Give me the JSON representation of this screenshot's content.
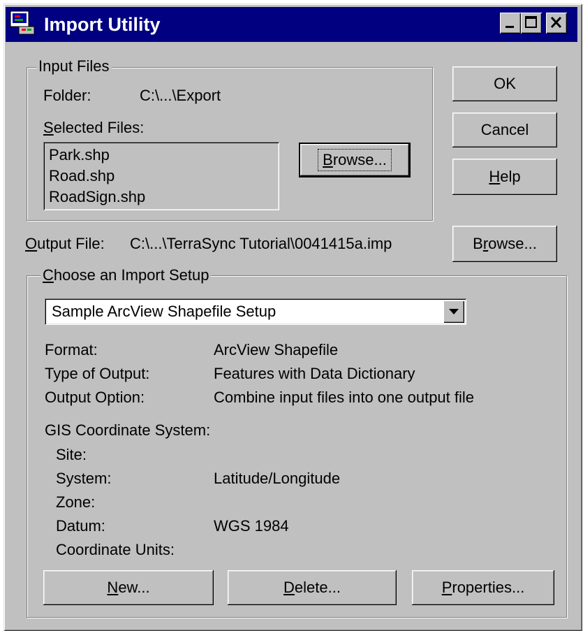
{
  "window": {
    "title": "Import Utility",
    "caption_icons": [
      "minimize-icon",
      "maximize-icon",
      "close-icon"
    ]
  },
  "input_files": {
    "legend": "Input Files",
    "folder_label": "Folder:",
    "folder_value": "C:\\...\\Export",
    "selected_label_hotkey": "S",
    "selected_label_rest": "elected Files:",
    "files": [
      "Park.shp",
      "Road.shp",
      "RoadSign.shp"
    ],
    "browse_hotkey": "B",
    "browse_rest": "rowse..."
  },
  "buttons": {
    "ok": "OK",
    "cancel": "Cancel",
    "help_hotkey": "H",
    "help_rest": "elp"
  },
  "output": {
    "label_hotkey": "O",
    "label_rest": "utput File:",
    "value": "C:\\...\\TerraSync Tutorial\\0041415a.imp",
    "browse_pre": "B",
    "browse_hotkey": "r",
    "browse_rest": "owse..."
  },
  "import_setup": {
    "legend_hotkey": "C",
    "legend_rest": "hoose an Import Setup",
    "selected_setup": "Sample ArcView Shapefile Setup",
    "format_label": "Format:",
    "format_value": "ArcView Shapefile",
    "type_label": "Type of Output:",
    "type_value": "Features with Data Dictionary",
    "option_label": "Output Option:",
    "option_value": "Combine input files into one output file",
    "gis_label": "GIS Coordinate System:",
    "site_label": "Site:",
    "system_label": "System:",
    "system_value": "Latitude/Longitude",
    "zone_label": "Zone:",
    "datum_label": "Datum:",
    "datum_value": "WGS 1984",
    "units_label": "Coordinate Units:",
    "new_hotkey": "N",
    "new_rest": "ew...",
    "delete_hotkey": "D",
    "delete_rest": "elete...",
    "properties_hotkey": "P",
    "properties_rest": "roperties..."
  },
  "colors": {
    "titlebar": "#000080",
    "face": "#c0c0c0"
  }
}
